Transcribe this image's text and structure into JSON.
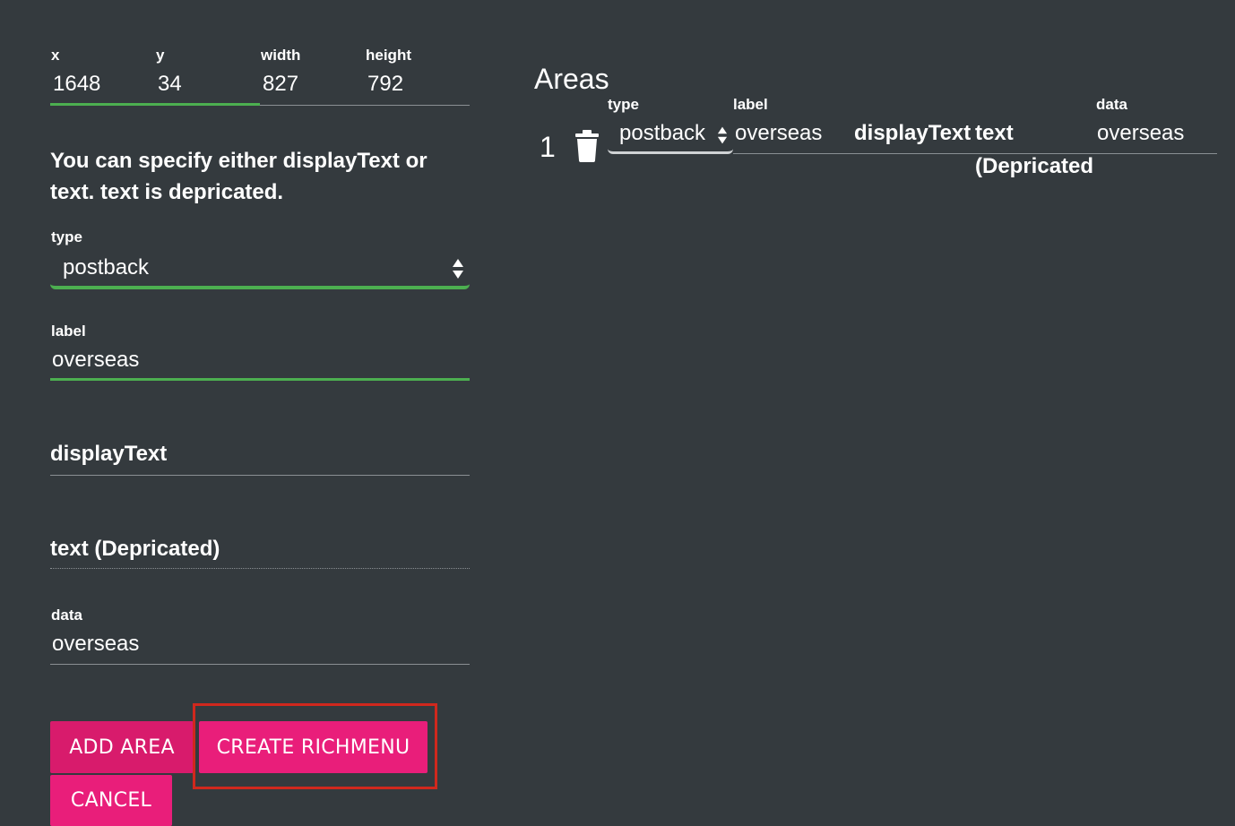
{
  "form": {
    "coords": [
      {
        "label": "x",
        "value": "1648"
      },
      {
        "label": "y",
        "value": "34"
      },
      {
        "label": "width",
        "value": "827"
      },
      {
        "label": "height",
        "value": "792"
      }
    ],
    "notice": "You can specify either displayText or text. text is depricated.",
    "type": {
      "label": "type",
      "value": "postback"
    },
    "label": {
      "label": "label",
      "value": "overseas"
    },
    "display_text": {
      "placeholder": "displayText"
    },
    "text": {
      "placeholder": "text (Depricated)"
    },
    "data": {
      "label": "data",
      "value": "overseas"
    },
    "buttons": {
      "add_area": "ADD AREA",
      "create_richmenu": "CREATE RICHMENU",
      "cancel": "CANCEL"
    }
  },
  "areas": {
    "title": "Areas",
    "columns": {
      "type": "type",
      "label": "label",
      "data": "data"
    },
    "rows": [
      {
        "index": "1",
        "type": "postback",
        "label": "overseas",
        "display_text_header": "displayText",
        "text_header_line1": "text",
        "text_header_line2": "(Depricated",
        "data": "overseas"
      }
    ]
  },
  "colors": {
    "background": "#343a3e",
    "accent_pink": "#e91e7a",
    "focus_green": "#4caf50",
    "highlight_red": "#d0281d"
  }
}
